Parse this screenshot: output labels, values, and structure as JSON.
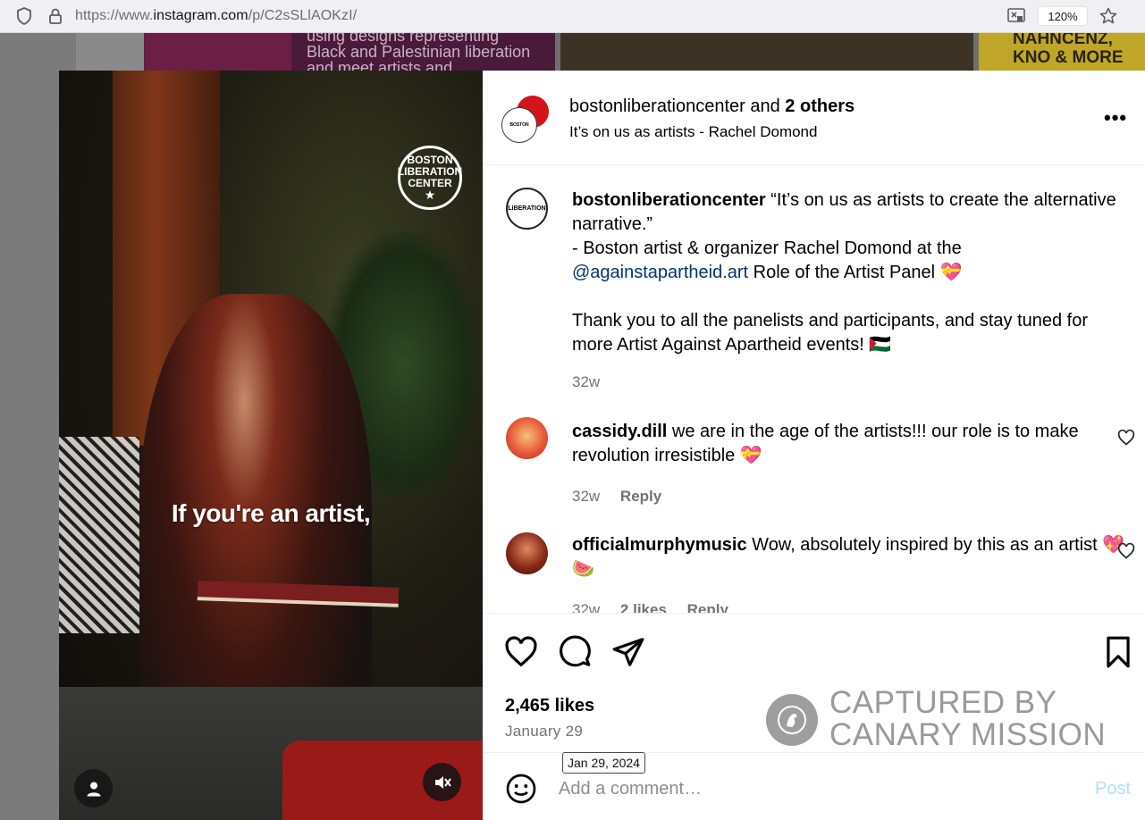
{
  "browser": {
    "url_prefix": "https://www.",
    "url_domain": "instagram.com",
    "url_path": "/p/C2sSLlAOKzI/",
    "zoom": "120%"
  },
  "background": {
    "thumb1_text": "using designs representing Black and Palestinian liberation and meet artists and",
    "thumb3_text": "NAHNCENZ, KNO & MORE"
  },
  "media": {
    "logo_lines": [
      "BOSTON",
      "LIBERATION",
      "CENTER"
    ],
    "caption": "If you're an artist,"
  },
  "header": {
    "username": "bostonliberationcenter",
    "and_text": "and",
    "others": "2 others",
    "subtitle": "It’s on us as artists - Rachel Domond",
    "more_icon": "more-horizontal-icon"
  },
  "post_caption": {
    "username": "bostonliberationcenter",
    "line1": "“It’s on us as artists to create the alternative narrative.”",
    "line2": "- Boston artist & organizer Rachel Domond at the",
    "mention": "@againstapartheid.art",
    "line3": "Role of the Artist Panel 💝",
    "line4": "Thank you to all the panelists and participants, and stay tuned for more Artist Against Apartheid events! 🇵🇸",
    "time": "32w"
  },
  "comments": [
    {
      "username": "cassidy.dill",
      "text": "we are in the age of the artists!!! our role is to make revolution irresistible 💝",
      "time": "32w",
      "reply": "Reply"
    },
    {
      "username": "officialmurphymusic",
      "text": "Wow, absolutely inspired by this as an artist 💖 🍉",
      "time": "32w",
      "likes": "2 likes",
      "reply": "Reply"
    }
  ],
  "actions": {
    "likes": "2,465 likes",
    "date": "January 29",
    "tooltip": "Jan 29, 2024"
  },
  "watermark": {
    "line1": "CAPTURED BY",
    "line2": "CANARY MISSION"
  },
  "add_comment": {
    "placeholder": "Add a comment…",
    "post": "Post"
  },
  "colors": {
    "link": "#00376b",
    "muted": "#737373",
    "post_disabled": "#b2dffc"
  }
}
